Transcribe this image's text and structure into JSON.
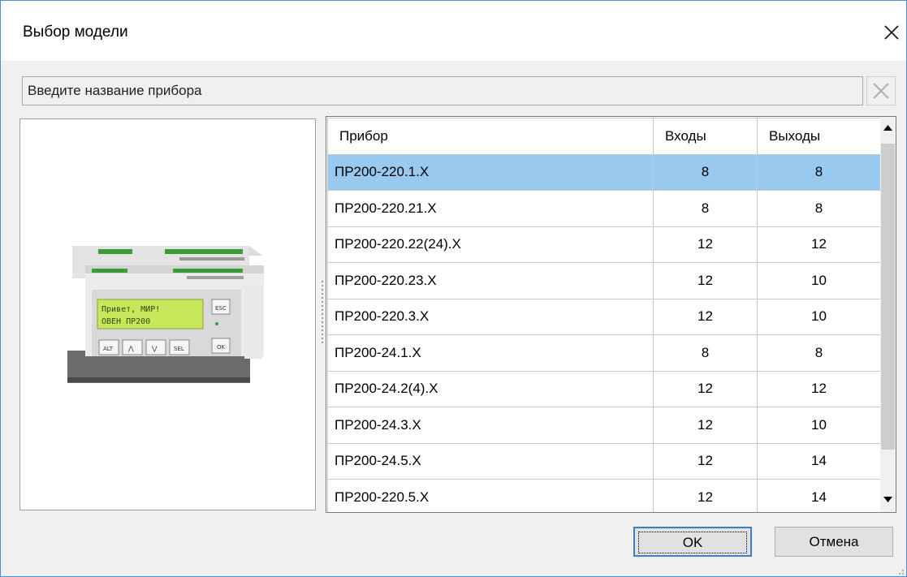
{
  "window": {
    "title": "Выбор модели"
  },
  "search": {
    "placeholder": "Введите название прибора",
    "value": ""
  },
  "table": {
    "columns": [
      "Прибор",
      "Входы",
      "Выходы"
    ],
    "rows": [
      {
        "name": "ПР200-220.1.X",
        "inputs": "8",
        "outputs": "8"
      },
      {
        "name": "ПР200-220.21.X",
        "inputs": "8",
        "outputs": "8"
      },
      {
        "name": "ПР200-220.22(24).X",
        "inputs": "12",
        "outputs": "12"
      },
      {
        "name": "ПР200-220.23.X",
        "inputs": "12",
        "outputs": "10"
      },
      {
        "name": "ПР200-220.3.X",
        "inputs": "12",
        "outputs": "10"
      },
      {
        "name": "ПР200-24.1.X",
        "inputs": "8",
        "outputs": "8"
      },
      {
        "name": "ПР200-24.2(4).X",
        "inputs": "12",
        "outputs": "12"
      },
      {
        "name": "ПР200-24.3.X",
        "inputs": "12",
        "outputs": "10"
      },
      {
        "name": "ПР200-24.5.X",
        "inputs": "12",
        "outputs": "14"
      },
      {
        "name": "ПР200-220.5.X",
        "inputs": "12",
        "outputs": "14"
      }
    ],
    "selected_index": 0
  },
  "device": {
    "lcd_line1": "Привет, МИР!",
    "lcd_line2": "ОВЕН ПР200",
    "keys": {
      "esc": "ESC",
      "ok": "OK",
      "alt": "ALT",
      "up": "⋀",
      "down": "⋁",
      "sel": "SEL"
    }
  },
  "buttons": {
    "ok": "OK",
    "cancel": "Отмена"
  },
  "colors": {
    "accent": "#3c7fc4",
    "selection": "#99c9ef",
    "lcd": "#c7e85a"
  }
}
